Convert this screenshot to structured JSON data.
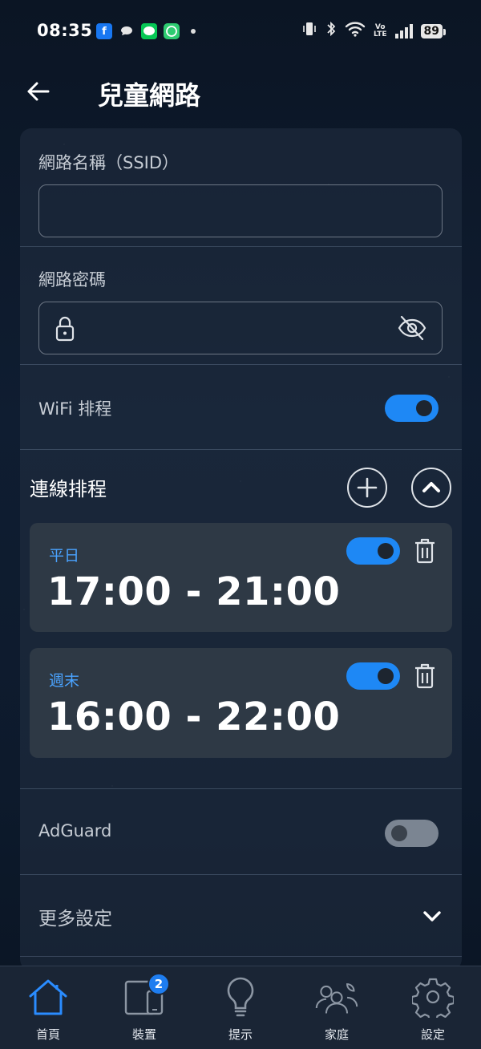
{
  "status_bar": {
    "time": "08:35",
    "battery": "89",
    "volte_top": "Vo",
    "volte_bottom": "LTE"
  },
  "header": {
    "title": "兒童網路"
  },
  "form": {
    "ssid_label": "網路名稱（SSID）",
    "ssid_value": "",
    "password_label": "網路密碼",
    "password_value": ""
  },
  "wifi_schedule": {
    "label": "WiFi 排程",
    "enabled": true
  },
  "connection_schedule": {
    "title": "連線排程",
    "items": [
      {
        "day": "平日",
        "time": "17:00 - 21:00",
        "enabled": true
      },
      {
        "day": "週末",
        "time": "16:00 - 22:00",
        "enabled": true
      }
    ]
  },
  "adguard": {
    "label": "AdGuard",
    "enabled": false
  },
  "more_settings": {
    "label": "更多設定"
  },
  "bottom_nav": {
    "items": [
      {
        "label": "首頁",
        "icon": "home-icon",
        "active": true
      },
      {
        "label": "裝置",
        "icon": "devices-icon",
        "badge": "2"
      },
      {
        "label": "提示",
        "icon": "lightbulb-icon"
      },
      {
        "label": "家庭",
        "icon": "family-icon"
      },
      {
        "label": "設定",
        "icon": "gear-icon"
      }
    ]
  },
  "colors": {
    "accent": "#1e88f5",
    "schedule_day": "#4aa3ff",
    "toggle_off": "#7b8592",
    "card": "#2e3945",
    "active_nav": "#2a8cff"
  }
}
